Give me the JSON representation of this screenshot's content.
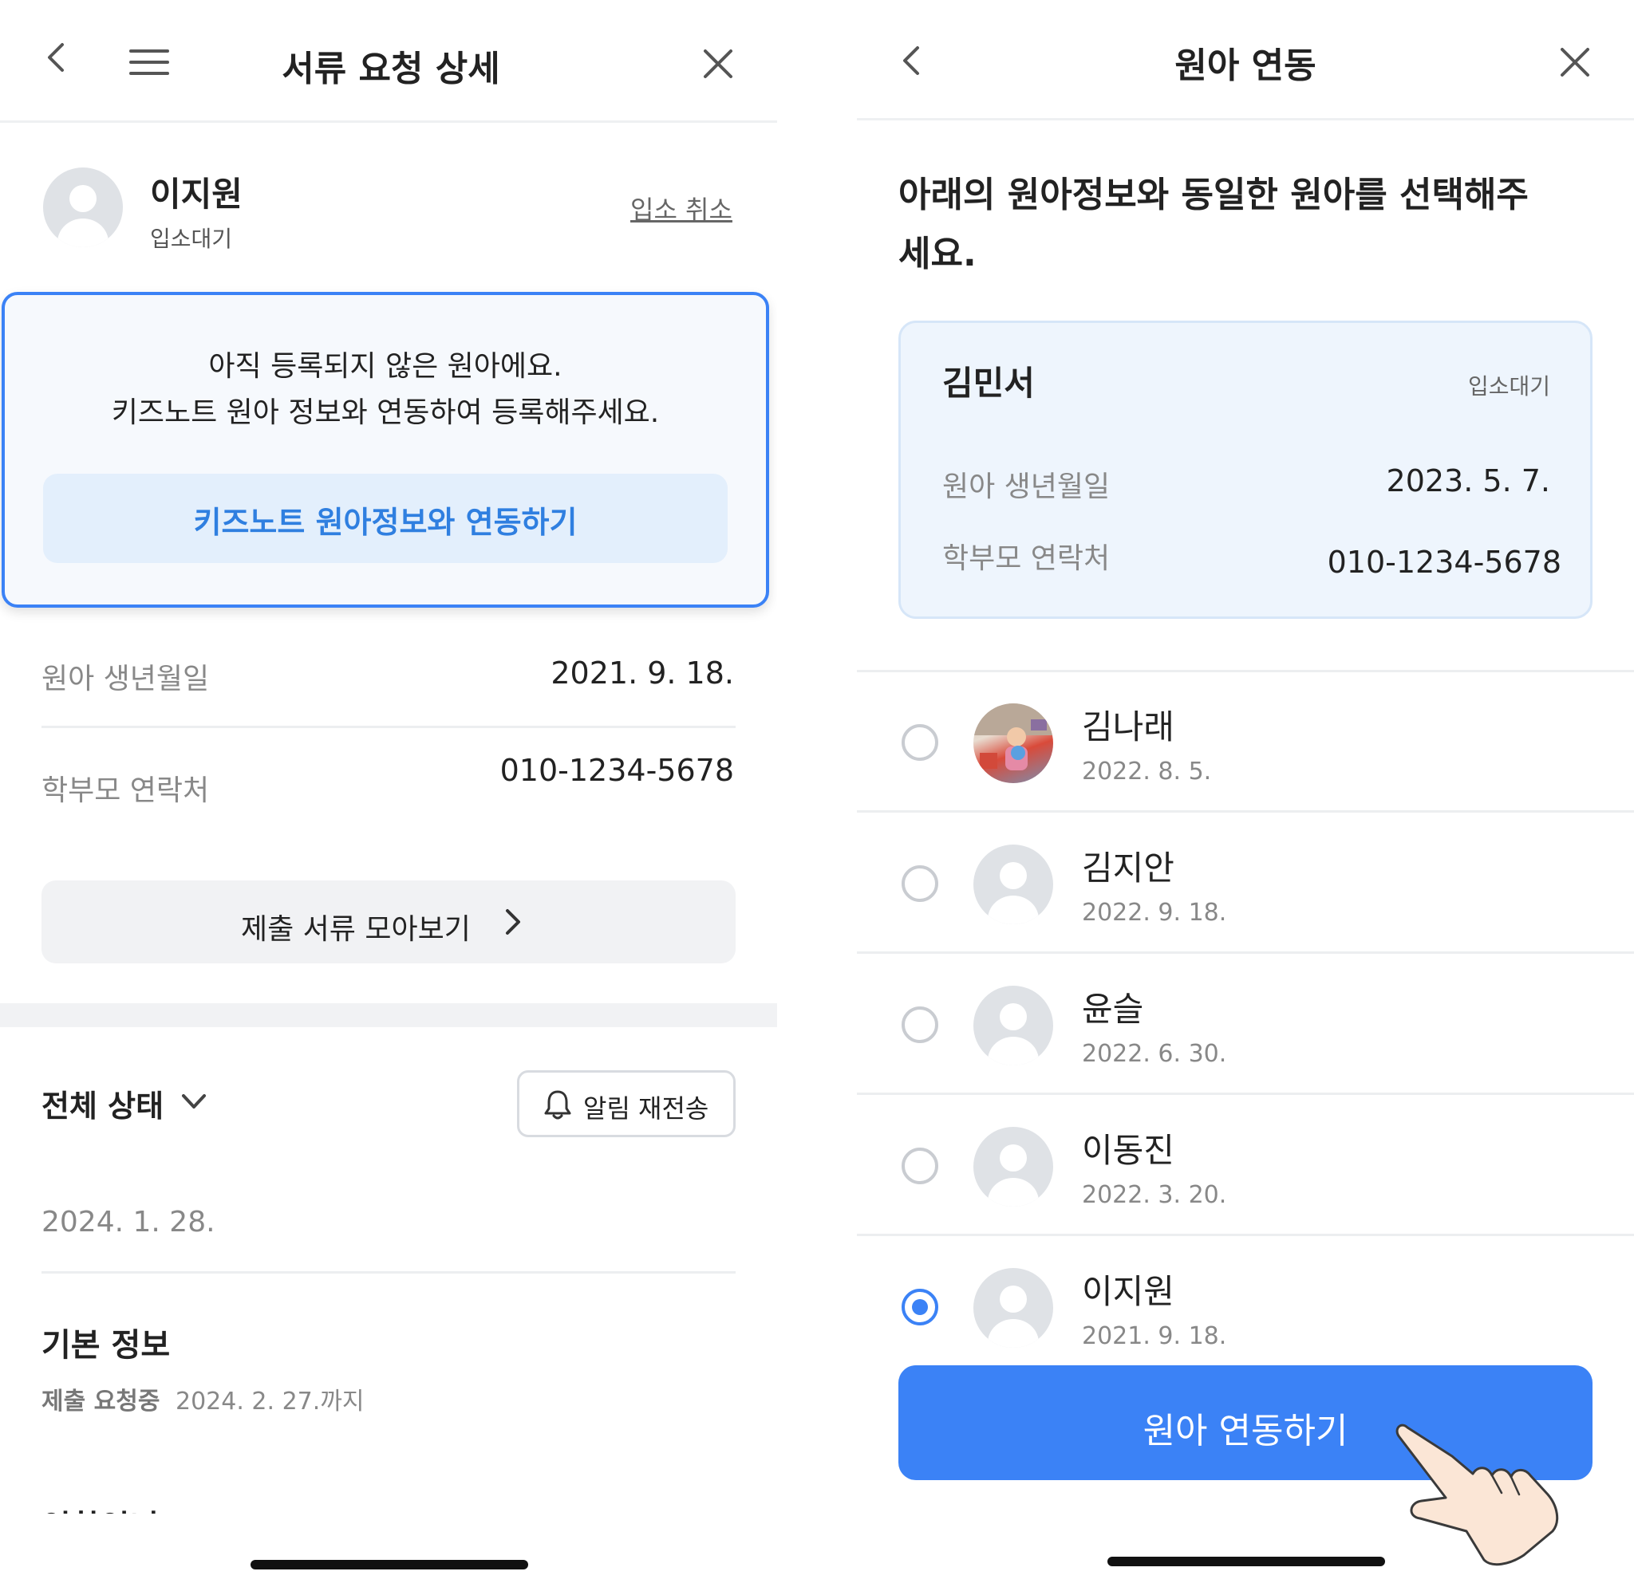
{
  "left": {
    "header": {
      "title": "서류 요청 상세"
    },
    "profile": {
      "name": "이지원",
      "status": "입소대기",
      "cancel_link": "입소 취소"
    },
    "notice": {
      "line1": "아직 등록되지 않은 원아에요.",
      "line2": "키즈노트 원아 정보와 연동하여 등록해주세요.",
      "button": "키즈노트 원아정보와 연동하기"
    },
    "info": {
      "birth_label": "원아 생년월일",
      "birth_value": "2021. 9. 18.",
      "contact_label": "학부모 연락처",
      "contact_value": "010-1234-5678"
    },
    "docs_button": "제출 서류 모아보기",
    "status": {
      "title": "전체 상태",
      "resend_button": "알림 재전송"
    },
    "date": "2024. 1. 28.",
    "basic": {
      "title": "기본 정보",
      "badge": "제출 요청중",
      "deadline": "2024. 2. 27.까지"
    },
    "cut_text": "인학인니"
  },
  "right": {
    "header": {
      "title": "원아 연동"
    },
    "instruction_line1": "아래의 원아정보와 동일한 원아를 선택해주",
    "instruction_line2": "세요.",
    "card": {
      "name": "김민서",
      "status": "입소대기",
      "birth_label": "원아 생년월일",
      "birth_value": "2023. 5. 7.",
      "contact_label": "학부모 연락처",
      "contact_value": "010-1234-5678"
    },
    "children": [
      {
        "name": "김나래",
        "date": "2022. 8. 5.",
        "selected": false,
        "photo": true
      },
      {
        "name": "김지안",
        "date": "2022. 9. 18.",
        "selected": false,
        "photo": false
      },
      {
        "name": "윤슬",
        "date": "2022. 6. 30.",
        "selected": false,
        "photo": false
      },
      {
        "name": "이동진",
        "date": "2022. 3. 20.",
        "selected": false,
        "photo": false
      },
      {
        "name": "이지원",
        "date": "2021. 9. 18.",
        "selected": true,
        "photo": false
      }
    ],
    "link_button": "원아 연동하기"
  },
  "colors": {
    "accent": "#3b82f6",
    "accent_text": "#2f7fe0",
    "card_bg": "#eef5fd",
    "grey_button": "#f1f2f4"
  }
}
